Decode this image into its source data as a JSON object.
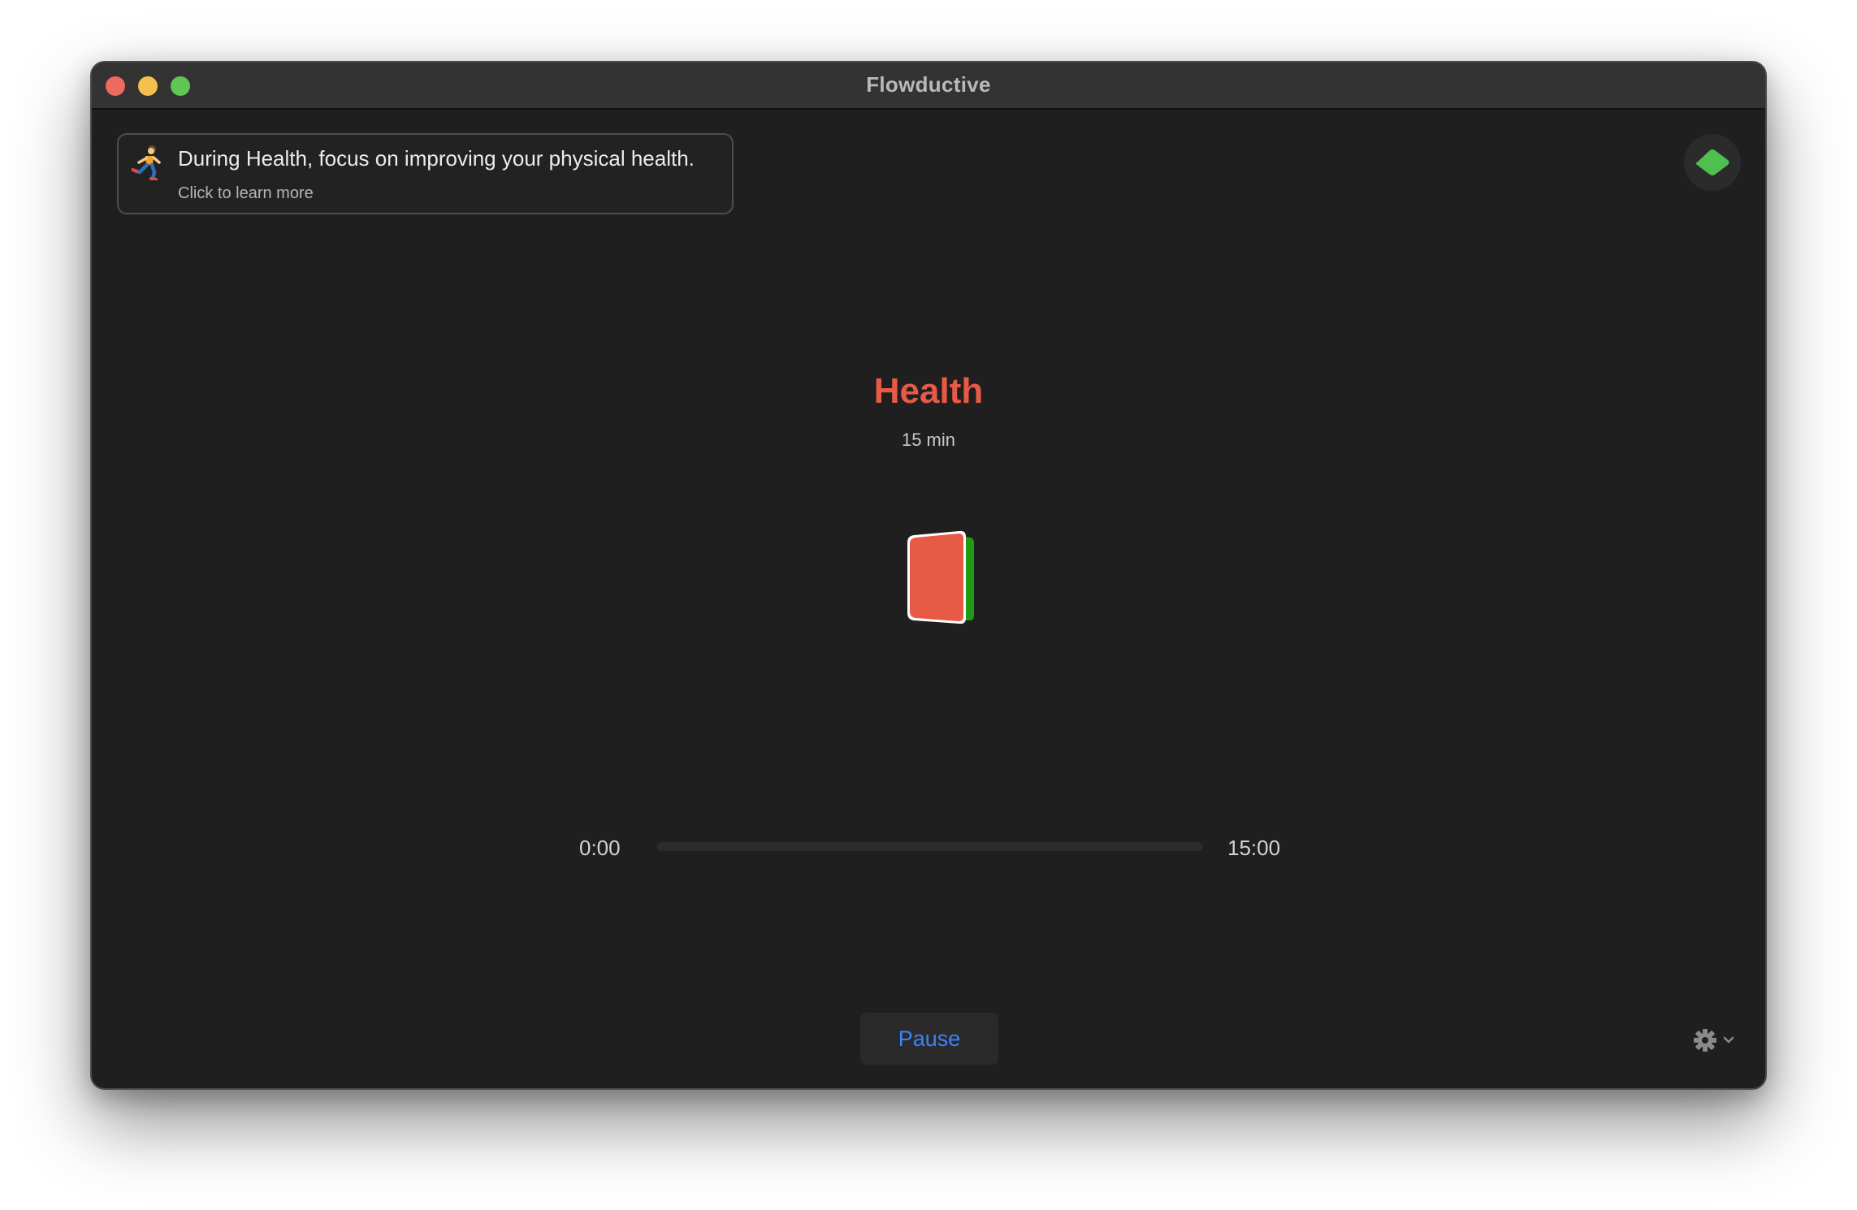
{
  "window": {
    "title": "Flowductive"
  },
  "tip": {
    "icon": "running-person-icon",
    "title": "During Health, focus on improving your physical health.",
    "subtitle": "Click to learn more"
  },
  "session": {
    "name": "Health",
    "duration": "15 min",
    "accent_color": "#e65a46",
    "secondary_color": "#1f9a12"
  },
  "timer": {
    "elapsed": "0:00",
    "total": "15:00",
    "progress": 0
  },
  "controls": {
    "pause_label": "Pause",
    "settings_icon": "gear-icon",
    "settings_menu_icon": "chevron-down-icon",
    "top_right_icon": "green-tag-icon"
  }
}
